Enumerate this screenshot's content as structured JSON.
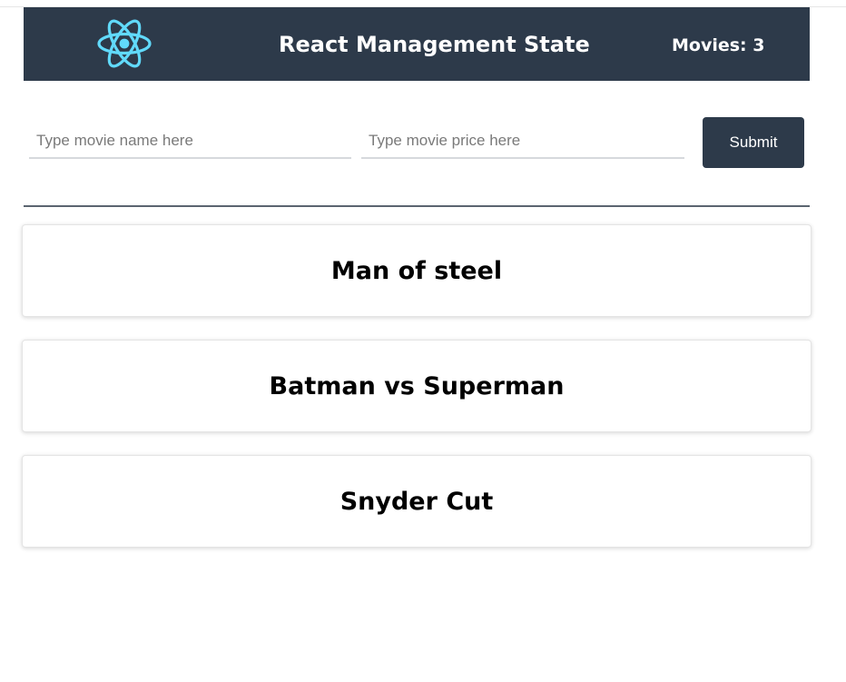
{
  "header": {
    "title": "React Management State",
    "movie_count_label": "Movies: 3",
    "logo_icon": "react-atom-icon",
    "background_color": "#2d3a4a",
    "logo_color": "#61dafb"
  },
  "form": {
    "name_input": {
      "placeholder": "Type movie name here",
      "value": ""
    },
    "price_input": {
      "placeholder": "Type movie price here",
      "value": ""
    },
    "submit_label": "Submit"
  },
  "movies": [
    {
      "title": "Man of steel"
    },
    {
      "title": "Batman vs Superman"
    },
    {
      "title": "Snyder Cut"
    }
  ]
}
